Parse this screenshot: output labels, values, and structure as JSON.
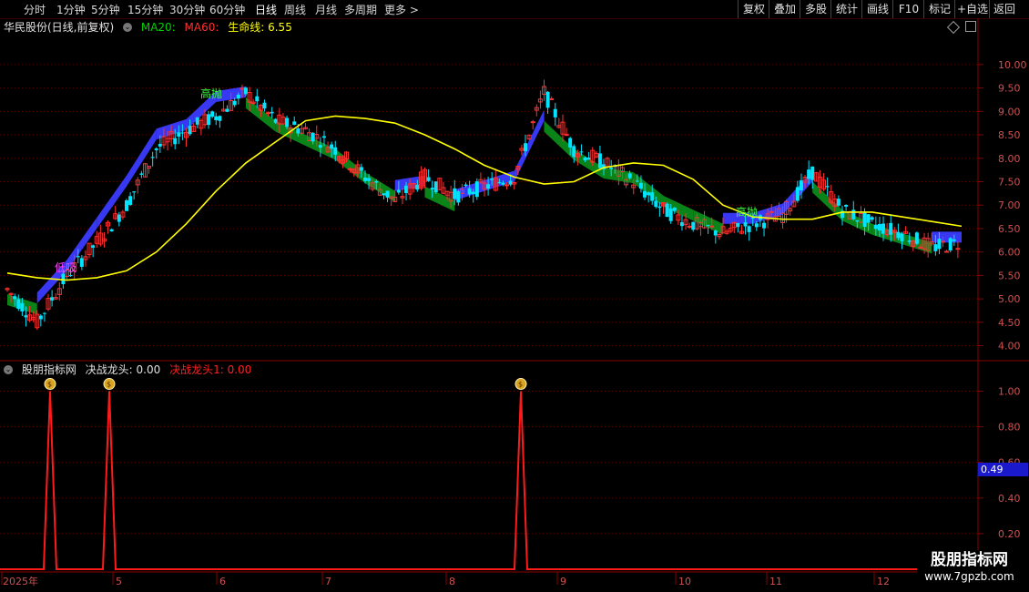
{
  "toolbar": {
    "timeframes": [
      {
        "label": "分时",
        "active": false
      },
      {
        "label": "1分钟",
        "active": false
      },
      {
        "label": "5分钟",
        "active": false
      },
      {
        "label": "15分钟",
        "active": false
      },
      {
        "label": "30分钟",
        "active": false
      },
      {
        "label": "60分钟",
        "active": false
      },
      {
        "label": "日线",
        "active": true
      },
      {
        "label": "周线",
        "active": false
      },
      {
        "label": "月线",
        "active": false
      },
      {
        "label": "多周期",
        "active": false
      },
      {
        "label": "更多 >",
        "active": false
      }
    ],
    "buttons": [
      "复权",
      "叠加",
      "多股",
      "统计",
      "画线",
      "F10",
      "标记",
      "+自选",
      "返回"
    ]
  },
  "main_panel": {
    "stock_title": "华民股份(日线,前复权)",
    "ma20_label": "MA20:",
    "ma60_label": "MA60:",
    "lifeline_label": "生命线: 6.55",
    "annotations": [
      "高抛",
      "高抛",
      "低吸"
    ]
  },
  "sub_panel": {
    "indicator_name": "股朋指标网",
    "label1": "决战龙头: 0.00",
    "label2": "决战龙头1: 0.00",
    "current_value": "0.49"
  },
  "watermark": {
    "title": "股朋指标网",
    "url": "www.7gpzb.com"
  },
  "colors": {
    "up": "#ff3030",
    "down": "#00e5ff",
    "lifeline": "#ffff00",
    "band_up": "#3b3bff",
    "band_down": "#0b8a1a",
    "indicator": "#ff1a1a",
    "grid": "#5a0000",
    "ma20": "#00d000",
    "ma60": "#ff3030"
  },
  "chart_data": [
    {
      "type": "line",
      "title": "华民股份(日线,前复权)",
      "y_ticks": [
        4.0,
        4.5,
        5.0,
        5.5,
        6.0,
        6.5,
        7.0,
        7.5,
        8.0,
        8.5,
        9.0,
        9.5,
        10.0
      ],
      "x_ticks": [
        "2025年",
        "5",
        "6",
        "7",
        "8",
        "9",
        "10",
        "11",
        "12"
      ],
      "ylim": [
        3.7,
        10.6
      ],
      "series": [
        {
          "name": "生命线",
          "values": [
            5.55,
            5.45,
            5.4,
            5.45,
            5.6,
            6.0,
            6.6,
            7.3,
            7.9,
            8.35,
            8.8,
            8.9,
            8.85,
            8.75,
            8.5,
            8.2,
            7.85,
            7.6,
            7.45,
            7.5,
            7.8,
            7.9,
            7.85,
            7.55,
            7.0,
            6.75,
            6.7,
            6.7,
            6.85,
            6.85,
            6.75,
            6.65,
            6.55
          ]
        }
      ],
      "band": [
        5.1,
        4.9,
        5.6,
        6.5,
        7.4,
        8.4,
        8.6,
        9.2,
        9.3,
        8.8,
        8.5,
        8.2,
        7.7,
        7.3,
        7.4,
        7.1,
        7.3,
        7.5,
        8.8,
        8.2,
        7.8,
        7.7,
        7.2,
        6.9,
        6.6,
        6.6,
        6.8,
        7.5,
        6.9,
        6.6,
        6.4,
        6.2,
        6.2
      ],
      "candles_close": [
        5.2,
        4.5,
        5.5,
        6.2,
        7.0,
        8.2,
        8.6,
        8.9,
        9.4,
        8.8,
        8.6,
        8.2,
        7.6,
        7.1,
        7.6,
        7.2,
        7.4,
        7.6,
        9.4,
        8.2,
        7.9,
        7.5,
        6.9,
        6.6,
        6.4,
        6.6,
        6.8,
        7.7,
        6.9,
        6.6,
        6.4,
        6.1,
        6.2
      ]
    },
    {
      "type": "line",
      "title": "决战龙头",
      "y_ticks": [
        0.2,
        0.4,
        0.6,
        0.8,
        1.0
      ],
      "ylim": [
        0,
        1.1
      ],
      "series": [
        {
          "name": "决战龙头",
          "spikes_at": [
            "2025年4月下旬",
            "4月底",
            "8月下旬"
          ],
          "values": [
            0,
            1,
            0,
            1,
            0,
            1,
            0
          ]
        }
      ]
    }
  ]
}
